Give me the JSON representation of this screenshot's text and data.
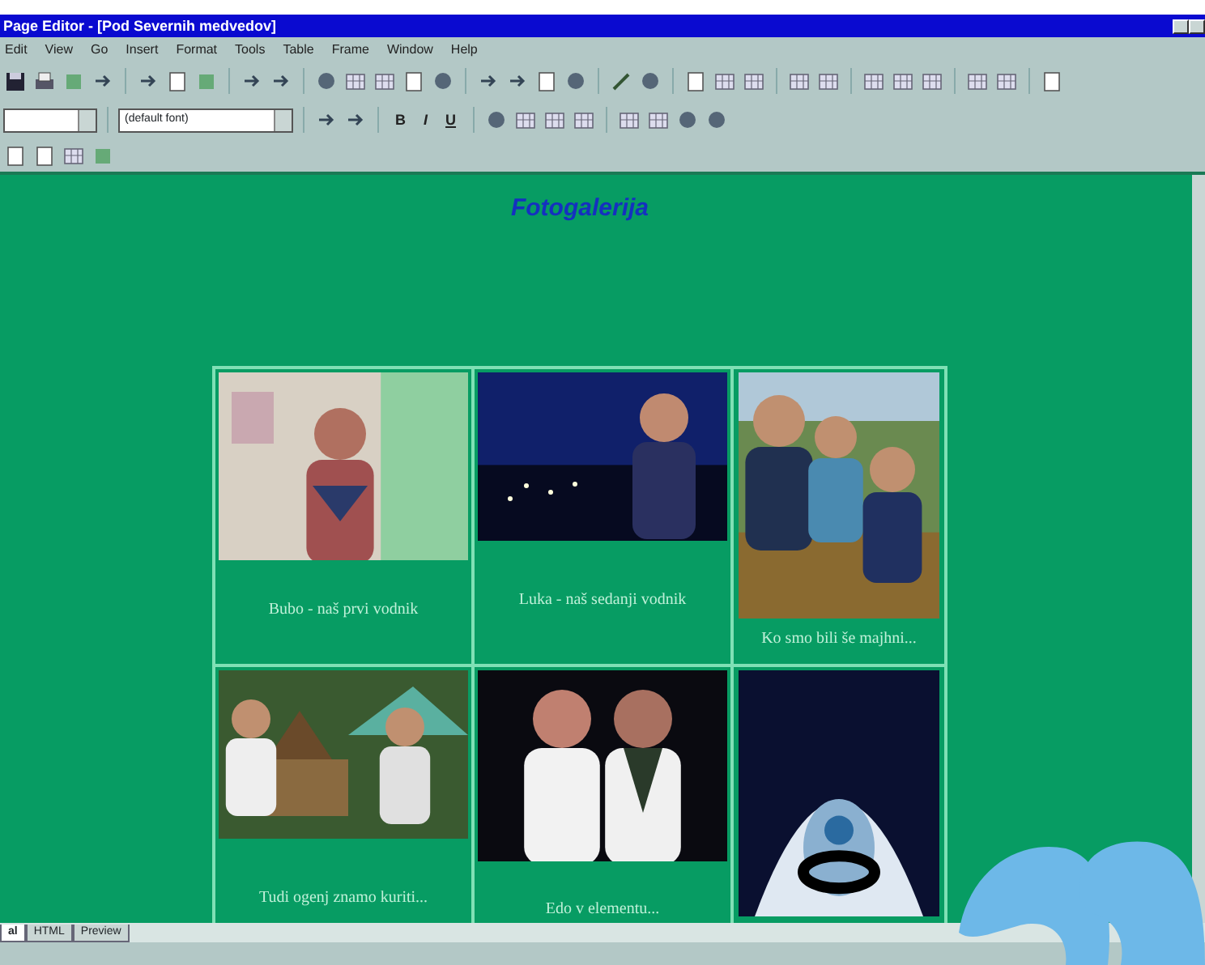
{
  "window": {
    "title": "Page Editor - [Pod Severnih medvedov]"
  },
  "menu": [
    "Edit",
    "View",
    "Go",
    "Insert",
    "Format",
    "Tools",
    "Table",
    "Frame",
    "Window",
    "Help"
  ],
  "format_toolbar": {
    "font_box": {
      "value": "(default font)"
    },
    "style_buttons": [
      "B",
      "I",
      "U"
    ]
  },
  "page": {
    "heading": "Fotogalerija",
    "gallery": [
      {
        "kind": "captioned",
        "caption": "Bubo - naš prvi vodnik"
      },
      {
        "kind": "captioned",
        "caption": "Luka - naš sedanji vodnik"
      },
      {
        "kind": "captioned",
        "caption": "Ko smo bili še majhni..."
      },
      {
        "kind": "captioned",
        "caption": "Tudi ogenj znamo kuriti..."
      },
      {
        "kind": "captioned",
        "caption": "Edo v elementu..."
      },
      {
        "kind": "picture"
      }
    ]
  },
  "view_tabs": [
    {
      "label": "al",
      "selected": true
    },
    {
      "label": "HTML",
      "selected": false
    },
    {
      "label": "Preview",
      "selected": false
    }
  ]
}
